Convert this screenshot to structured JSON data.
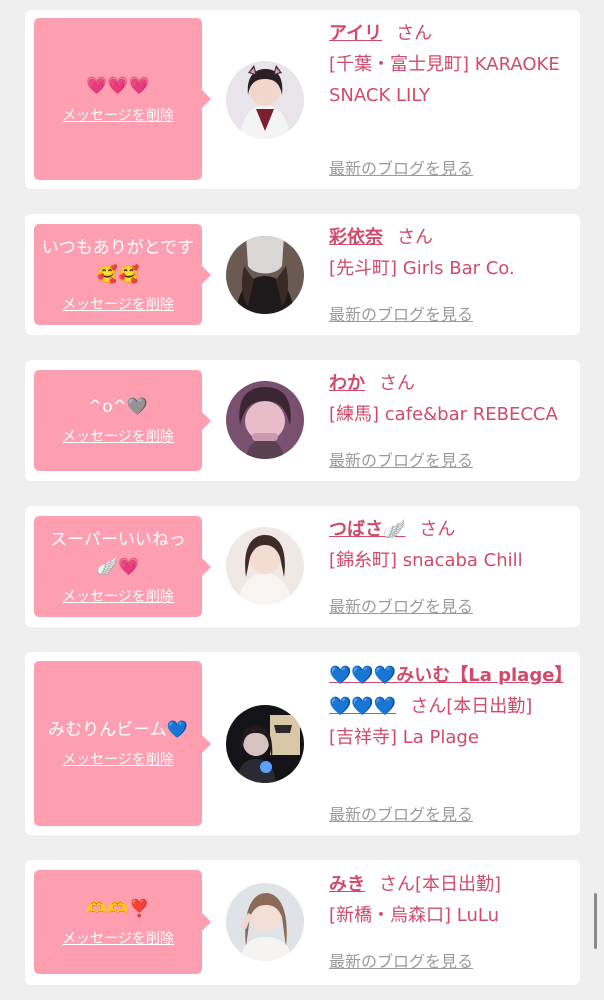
{
  "messages": [
    {
      "bubble_text": "💗💗💗",
      "delete_label": "メッセージを削除",
      "name": "アイリ",
      "honorific": "さん",
      "shop": "[千葉・富士見町] KARAOKE SNACK LILY",
      "blog_label": "最新のブログを見る"
    },
    {
      "bubble_text": "いつもありがとです🥰🥰",
      "delete_label": "メッセージを削除",
      "name": "彩依奈",
      "honorific": "さん",
      "shop": "[先斗町] Girls Bar Co.",
      "blog_label": "最新のブログを見る"
    },
    {
      "bubble_text": "^o^🩶",
      "delete_label": "メッセージを削除",
      "name": "わか",
      "honorific": "さん",
      "shop": "[練馬] cafe&bar REBECCA",
      "blog_label": "最新のブログを見る"
    },
    {
      "bubble_text": "スーパーいいねっ🪽💗",
      "delete_label": "メッセージを削除",
      "name": "つばさ🪽",
      "honorific": "さん",
      "shop": "[錦糸町] snacaba Chill",
      "blog_label": "最新のブログを見る"
    },
    {
      "bubble_text": "みむりんビーム💙",
      "delete_label": "メッセージを削除",
      "name": "💙💙💙みいむ【La plage】💙💙💙",
      "honorific": "さん[本日出勤]",
      "shop": "[吉祥寺] La Plage",
      "blog_label": "最新のブログを見る"
    },
    {
      "bubble_text": "🫶🫶❣️",
      "delete_label": "メッセージを削除",
      "name": "みき",
      "honorific": "さん[本日出勤]",
      "shop": "[新橋・烏森口] LuLu",
      "blog_label": "最新のブログを見る"
    }
  ],
  "colors": {
    "background": "#efefef",
    "bubble": "#fe9fb1",
    "accent": "#d24a69",
    "muted_link": "#9a9a9a"
  },
  "icons": [
    "avatar-photo"
  ]
}
